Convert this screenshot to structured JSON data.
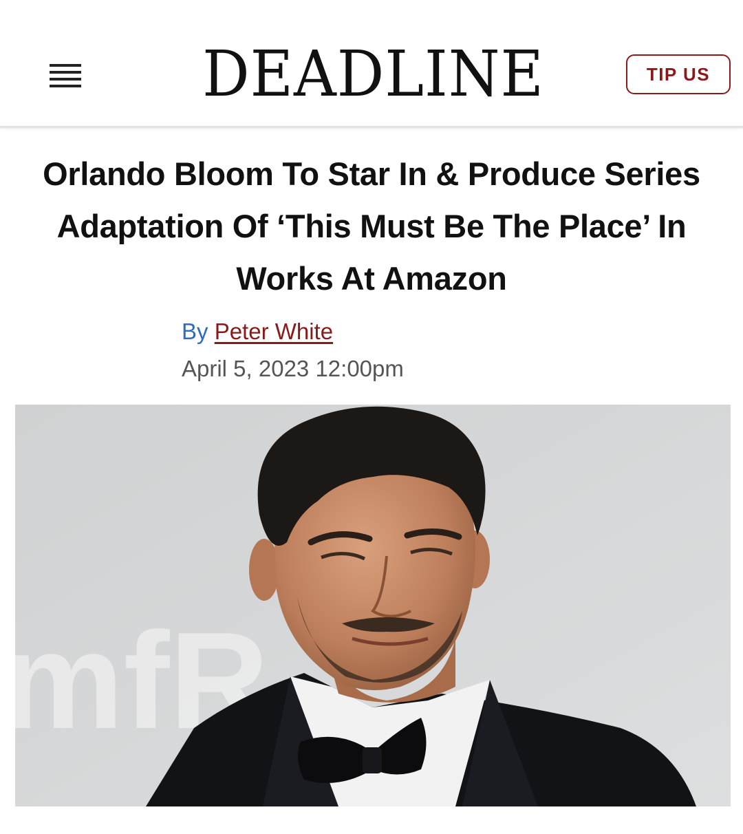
{
  "header": {
    "logo_text": "DEADLINE",
    "tip_label": "TIP US"
  },
  "article": {
    "headline": "Orlando Bloom To Star In & Produce Series Adaptation Of ‘This Must Be The Place’ In Works At Amazon",
    "byline_prefix": "By",
    "author": "Peter White",
    "date": "April 5, 2023 12:00pm"
  },
  "photo": {
    "backdrop_text": "mfR"
  },
  "colors": {
    "brand_red": "#8a1a1a",
    "byline_blue": "#2f6bbf"
  },
  "icons": {
    "menu": "hamburger-menu-icon"
  }
}
